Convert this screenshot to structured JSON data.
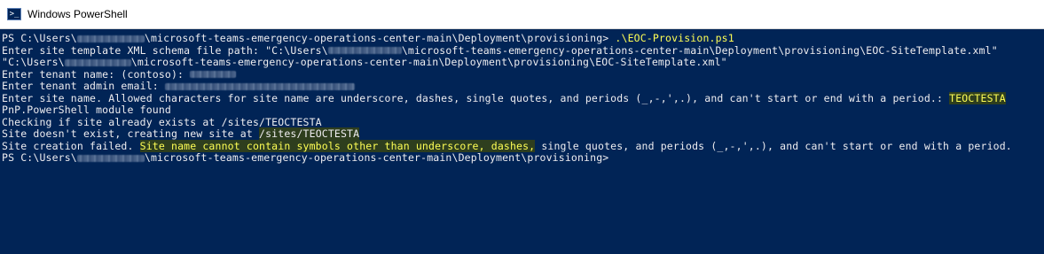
{
  "window": {
    "title": "Windows PowerShell"
  },
  "console": {
    "line1_prefix": "PS C:\\Users\\",
    "line1_path": "\\microsoft-teams-emergency-operations-center-main\\Deployment\\provisioning> ",
    "line1_command": ".\\EOC-Provision.ps1",
    "line2_prefix": "Enter site template XML schema file path: \"C:\\Users\\",
    "line2_suffix": "\\microsoft-teams-emergency-operations-center-main\\Deployment\\provisioning\\EOC-SiteTemplate.xml\"",
    "line3_prefix": "\"C:\\Users\\",
    "line3_suffix": "\\microsoft-teams-emergency-operations-center-main\\Deployment\\provisioning\\EOC-SiteTemplate.xml\"",
    "line4_prefix": "Enter tenant name: (contoso): ",
    "line5_prefix": "Enter tenant admin email: ",
    "line6_prefix": "Enter site name. Allowed characters for site name are underscore, dashes, single quotes, and periods (_,-,',.), and can't start or end with a period.: ",
    "line6_value": "TEOCTESTA",
    "line7": "PnP.PowerShell module found",
    "line8": "Checking if site already exists at /sites/TEOCTESTA",
    "line9_prefix": "Site doesn't exist, creating new site at ",
    "line9_value": "/sites/TEOCTESTA",
    "line10_prefix": "Site creation failed. ",
    "line10_highlight": "Site name cannot contain symbols other than underscore, dashes,",
    "line10_suffix": " single quotes, and periods (_,-,',.), and can't start or end with a period.",
    "line11_prefix": "PS C:\\Users\\",
    "line11_path": "\\microsoft-teams-emergency-operations-center-main\\Deployment\\provisioning>"
  },
  "colors": {
    "console_background": "#012456",
    "console_text": "#eeedf0",
    "command_text": "#ffff55",
    "highlight_background": "#2e3e1e"
  },
  "icons": {
    "app": "powershell-icon",
    "redaction": "redacted-text-blur"
  }
}
